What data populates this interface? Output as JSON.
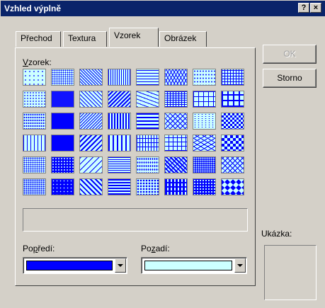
{
  "window": {
    "title": "Vzhled výplně",
    "help_button": "?",
    "close_button": "×"
  },
  "tabs": [
    {
      "label": "Přechod",
      "active": false
    },
    {
      "label": "Textura",
      "active": false
    },
    {
      "label": "Vzorek",
      "active": true
    },
    {
      "label": "Obrázek",
      "active": false
    }
  ],
  "pattern": {
    "label": "Vzorek:",
    "rows": 6,
    "columns": 8,
    "foreground_color": "#0000ff",
    "background_color": "#ccffff",
    "selected_index": null
  },
  "buttons": {
    "ok_label": "OK",
    "ok_enabled": false,
    "cancel_label": "Storno"
  },
  "foreground": {
    "label": "Popředí:",
    "color": "#0000ff"
  },
  "background": {
    "label": "Pozadí:",
    "color": "#ccffff"
  },
  "preview": {
    "label": "Ukázka:"
  },
  "icons": {
    "help": "question-mark-icon",
    "close": "close-icon",
    "dropdown": "chevron-down-icon"
  }
}
